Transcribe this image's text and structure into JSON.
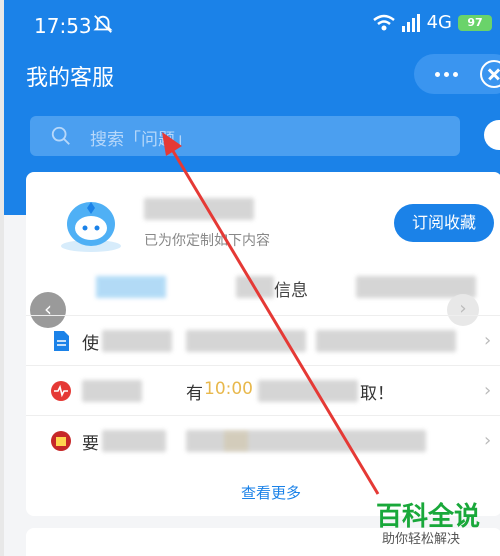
{
  "status_bar": {
    "time": "17:53",
    "network": "4G",
    "battery": "97"
  },
  "header": {
    "title": "我的客服"
  },
  "search": {
    "placeholder": "搜索「问题」"
  },
  "card": {
    "subtitle": "已为你定制如下内容",
    "subscribe_label": "订阅收藏",
    "tabs": [
      {
        "label": "信息"
      }
    ],
    "rows": [
      {
        "prefix": "使",
        "icon": "document-icon"
      },
      {
        "prefix": "",
        "middle": "有",
        "time": "10:00",
        "suffix": "取！",
        "icon": "heart-monitor-icon"
      },
      {
        "prefix": "要",
        "icon": "shop-icon"
      }
    ],
    "see_more": "查看更多"
  },
  "colors": {
    "brand_blue": "#1b82e8",
    "arrow_red": "#e53935",
    "watermark_green": "#19a83a"
  },
  "watermark": {
    "title": "百科全说",
    "subtitle": "助你轻松解决"
  }
}
